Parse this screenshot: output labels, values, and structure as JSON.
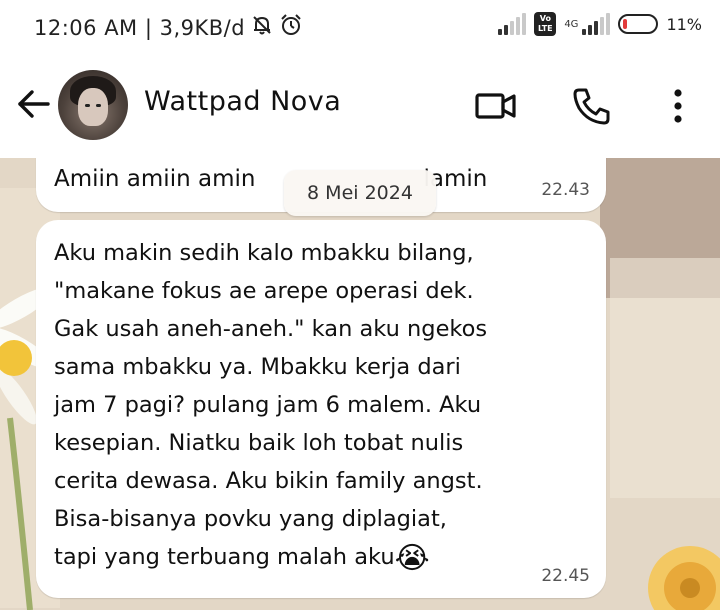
{
  "status_bar": {
    "time_speed": "12:06 AM | 3,9KB/d",
    "network_type": "4G",
    "volte_label": "Vo LTE",
    "battery_percent": "11%",
    "battery_level": 0.11,
    "icons": [
      "mute-bell-icon",
      "alarm-icon",
      "signal-icon",
      "volte-icon",
      "battery-icon"
    ]
  },
  "header": {
    "contact_name": "Wattpad Nova",
    "icons": [
      "back-arrow-icon",
      "avatar",
      "video-call-icon",
      "phone-icon",
      "more-vert-icon"
    ]
  },
  "chat": {
    "date_chip": "8 Mei 2024",
    "messages": [
      {
        "text": "Amiin amiin amin ya robbal alamin",
        "visible_text": "Amiin amiin amin",
        "visible_text_end": "lamin",
        "time": "22.43"
      },
      {
        "text": "Aku makin sedih kalo mbakku bilang,\n\"makane fokus ae arepe operasi dek.\nGak usah aneh-aneh.\" kan aku ngekos\nsama mbakku ya. Mbakku kerja dari\njam 7 pagi? pulang jam 6 malem. Aku\nkesepian. Niatku baik loh tobat nulis\ncerita dewasa. Aku bikin family angst.\nBisa-bisanya povku yang diplagiat,\ntapi yang terbuang malah aku",
        "emoji": "😭",
        "time": "22.45"
      }
    ]
  },
  "colors": {
    "bubble": "#ffffff",
    "wallpaper": "#e7dccd",
    "text": "#111111",
    "time": "#555555"
  }
}
